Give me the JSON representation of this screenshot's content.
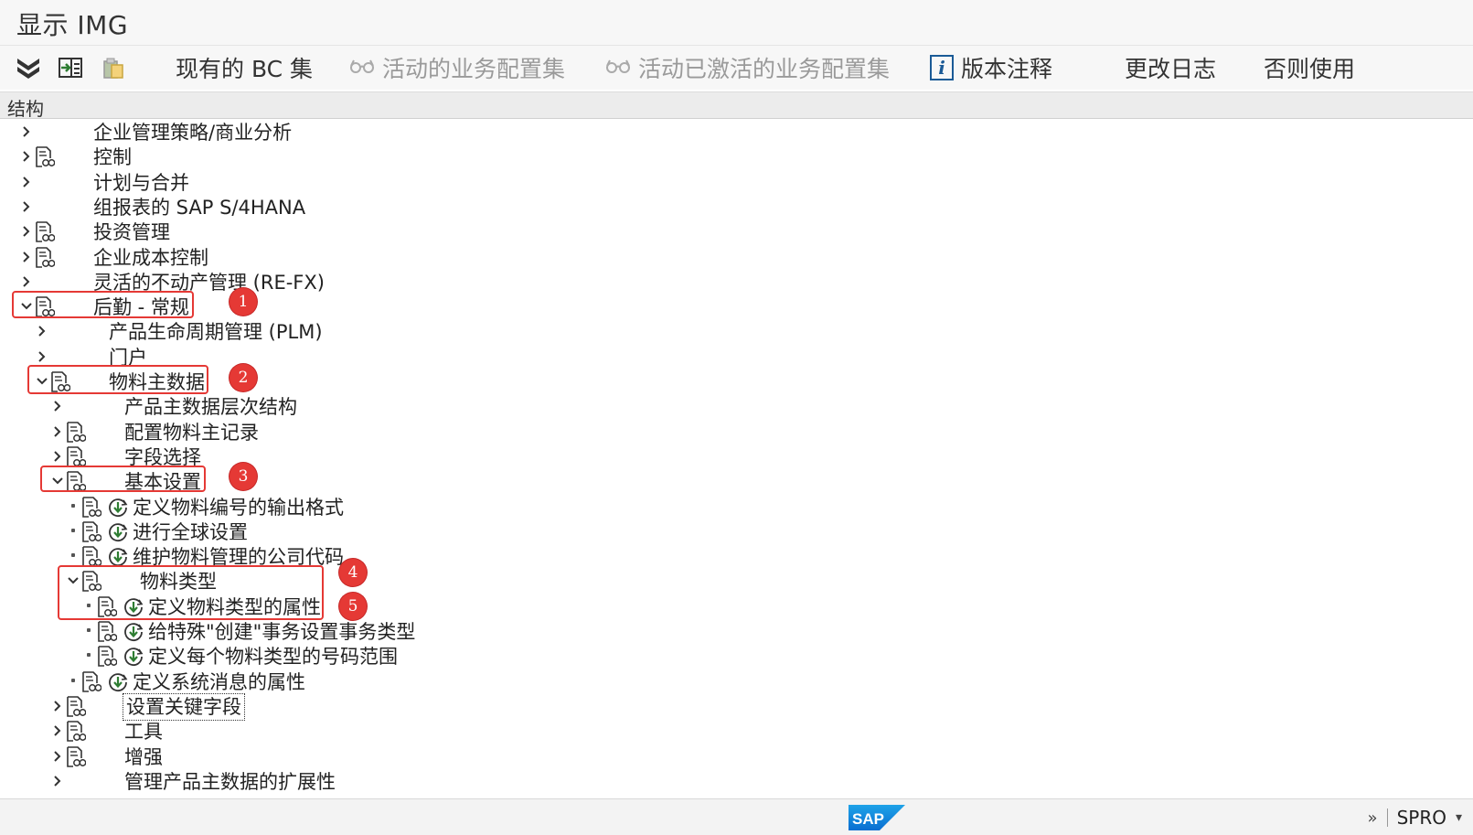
{
  "window": {
    "title": "显示 IMG"
  },
  "toolbar": {
    "icons": [
      "expand-all-icon",
      "import-icon",
      "clipboard-icon"
    ],
    "buttons": [
      {
        "label": "现有的 BC 集",
        "enabled": true
      },
      {
        "label": "活动的业务配置集",
        "enabled": false,
        "icon": "glasses-icon"
      },
      {
        "label": "活动已激活的业务配置集",
        "enabled": false,
        "icon": "glasses-icon"
      },
      {
        "label": "版本注释",
        "enabled": true,
        "icon": "info-icon"
      },
      {
        "label": "更改日志",
        "enabled": true
      },
      {
        "label": "否则使用",
        "enabled": true
      }
    ]
  },
  "structure_header": "结构",
  "tree": [
    {
      "label": "企业管理策略/商业分析",
      "level": 0,
      "state": "collapsed",
      "doc": false,
      "exec": false
    },
    {
      "label": "控制",
      "level": 0,
      "state": "collapsed",
      "doc": true,
      "exec": false
    },
    {
      "label": "计划与合并",
      "level": 0,
      "state": "collapsed",
      "doc": false,
      "exec": false
    },
    {
      "label": "组报表的 SAP S/4HANA",
      "level": 0,
      "state": "collapsed",
      "doc": false,
      "exec": false
    },
    {
      "label": "投资管理",
      "level": 0,
      "state": "collapsed",
      "doc": true,
      "exec": false
    },
    {
      "label": "企业成本控制",
      "level": 0,
      "state": "collapsed",
      "doc": true,
      "exec": false
    },
    {
      "label": "灵活的不动产管理 (RE-FX)",
      "level": 0,
      "state": "collapsed",
      "doc": false,
      "exec": false
    },
    {
      "label": "后勤 - 常规",
      "level": 0,
      "state": "expanded",
      "doc": true,
      "exec": false
    },
    {
      "label": "产品生命周期管理 (PLM)",
      "level": 1,
      "state": "collapsed",
      "doc": false,
      "exec": false
    },
    {
      "label": "门户",
      "level": 1,
      "state": "collapsed",
      "doc": false,
      "exec": false
    },
    {
      "label": "物料主数据",
      "level": 1,
      "state": "expanded",
      "doc": true,
      "exec": false
    },
    {
      "label": "产品主数据层次结构",
      "level": 2,
      "state": "collapsed",
      "doc": false,
      "exec": false
    },
    {
      "label": "配置物料主记录",
      "level": 2,
      "state": "collapsed",
      "doc": true,
      "exec": false
    },
    {
      "label": "字段选择",
      "level": 2,
      "state": "collapsed",
      "doc": true,
      "exec": false
    },
    {
      "label": "基本设置",
      "level": 2,
      "state": "expanded",
      "doc": true,
      "exec": false
    },
    {
      "label": "定义物料编号的输出格式",
      "level": 3,
      "state": "leaf",
      "doc": true,
      "exec": true
    },
    {
      "label": "进行全球设置",
      "level": 3,
      "state": "leaf",
      "doc": true,
      "exec": true
    },
    {
      "label": "维护物料管理的公司代码",
      "level": 3,
      "state": "leaf",
      "doc": true,
      "exec": true
    },
    {
      "label": "物料类型",
      "level": 3,
      "state": "expanded",
      "doc": true,
      "exec": false
    },
    {
      "label": "定义物料类型的属性",
      "level": 4,
      "state": "leaf",
      "doc": true,
      "exec": true
    },
    {
      "label": "给特殊\"创建\"事务设置事务类型",
      "level": 4,
      "state": "leaf",
      "doc": true,
      "exec": true
    },
    {
      "label": "定义每个物料类型的号码范围",
      "level": 4,
      "state": "leaf",
      "doc": true,
      "exec": true
    },
    {
      "label": "定义系统消息的属性",
      "level": 3,
      "state": "leaf",
      "doc": true,
      "exec": true
    },
    {
      "label": "设置关键字段",
      "level": 2,
      "state": "collapsed",
      "doc": true,
      "exec": false,
      "focused": true
    },
    {
      "label": "工具",
      "level": 2,
      "state": "collapsed",
      "doc": true,
      "exec": false
    },
    {
      "label": "增强",
      "level": 2,
      "state": "collapsed",
      "doc": true,
      "exec": false
    },
    {
      "label": "管理产品主数据的扩展性",
      "level": 2,
      "state": "collapsed",
      "doc": false,
      "exec": false
    }
  ],
  "annotations": [
    "1",
    "2",
    "3",
    "4",
    "5"
  ],
  "status": {
    "logo": "SAP",
    "transaction": "SPRO"
  },
  "colors": {
    "annotation": "#e53935",
    "exec_icon": "#2e7d32",
    "info_icon": "#1a5a96",
    "sap_blue": "#0a6ed1"
  }
}
